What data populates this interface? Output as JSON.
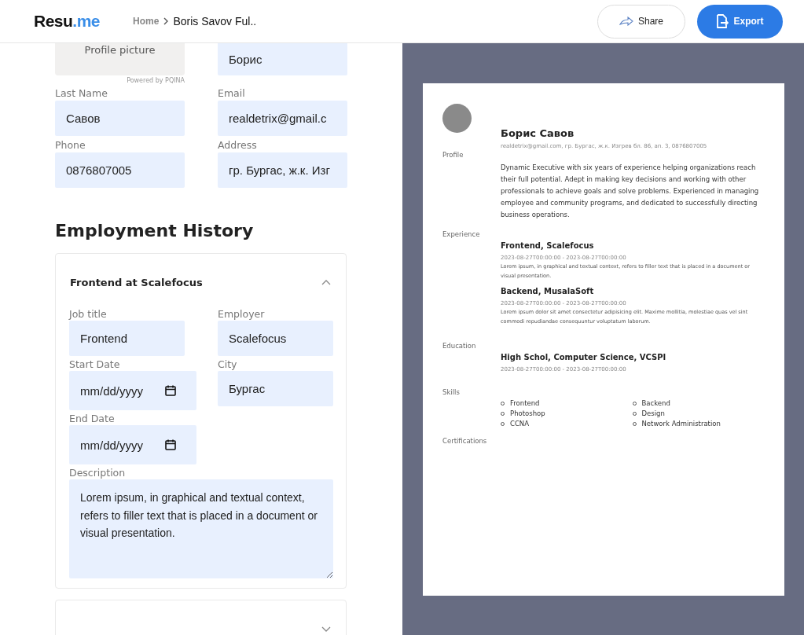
{
  "header": {
    "logo": {
      "text": "Resu",
      "accent": ".me"
    },
    "breadcrumb": [
      "Home",
      "Boris Savov Ful.."
    ],
    "share_button": "Share",
    "export_button": "Export"
  },
  "personal": {
    "profile_picture": {
      "label": "Profile picture",
      "credit": "Powered by PQINA"
    },
    "fields": [
      {
        "value": "Борис"
      },
      {
        "label": "Last Name",
        "value": "Савов"
      },
      {
        "label": "Email",
        "value": "realdetrix@gmail.c"
      },
      {
        "label": "Phone",
        "value": "0876807005"
      },
      {
        "label": "Address",
        "value": "гр. Бургас, ж.к. Изг"
      }
    ]
  },
  "employment": {
    "heading": "Employment History",
    "jobs": [
      {
        "title": "Frontend at Scalefocus",
        "expanded": true,
        "fields": [
          {
            "kind": "text",
            "label": "Job title",
            "value": "Frontend"
          },
          {
            "kind": "text",
            "label": "Employer",
            "value": "Scalefocus"
          },
          {
            "kind": "date",
            "label": "Start Date",
            "placeholder": "mm/dd/yyyy"
          },
          {
            "kind": "text",
            "label": "City",
            "value": "Бургас"
          },
          {
            "kind": "date",
            "label": "End Date",
            "placeholder": "mm/dd/yyyy"
          },
          {
            "kind": "textarea",
            "label": "Description",
            "value": "Lorem ipsum, in graphical and textual context, refers to filler text that is placed in a document or visual presentation."
          }
        ]
      },
      {
        "expanded": false
      }
    ]
  },
  "resume": {
    "name": "Борис Савов",
    "contact": "realdetrix@gmail.com, гр. Бургас, ж.к. Изгрев бл. 86, ап. 3, 0876807005",
    "sections": [
      {
        "kind": "text",
        "label": "Profile",
        "text": "Dynamic Executive with six years of experience helping organizations reach their full potential. Adept in making key decisions and working with other professionals to achieve goals and solve problems. Experienced in managing employee and community programs, and dedicated to successfully directing business operations."
      },
      {
        "kind": "entries",
        "label": "Experience",
        "entries": [
          {
            "title": "Frontend, Scalefocus",
            "dates": "2023-08-27T00:00:00 - 2023-08-27T00:00:00",
            "text": "Lorem ipsum, in graphical and textual context, refers to filler text that is placed in a document or visual presentation."
          },
          {
            "title": "Backend, MusalaSoft",
            "dates": "2023-08-27T00:00:00 - 2023-08-27T00:00:00",
            "text": "Lorem ipsum dolor sit amet consectetur adipisicing elit. Maxime mollitia, molestiae quas vel sint commodi repudiandae consequuntur voluptatum laborum."
          }
        ]
      },
      {
        "kind": "entries",
        "label": "Education",
        "entries": [
          {
            "title": "High Schol, Computer Science, VCSPI",
            "dates": "2023-08-27T00:00:00 - 2023-08-27T00:00:00"
          }
        ]
      },
      {
        "kind": "list",
        "label": "Skills",
        "items": [
          "Frontend",
          "Backend",
          "Photoshop",
          "Design",
          "CCNA",
          "Network Administration"
        ]
      },
      {
        "kind": "empty",
        "label": "Certifications"
      }
    ]
  }
}
